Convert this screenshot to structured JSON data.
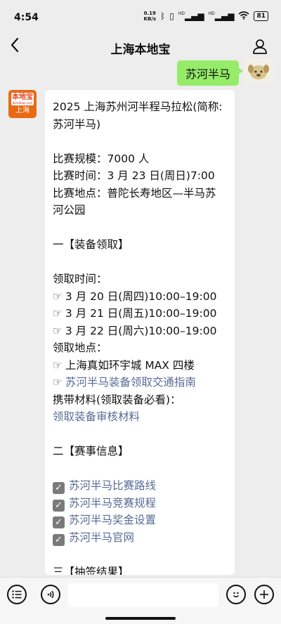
{
  "status": {
    "time": "4:54",
    "netspeed_value": "0.19",
    "netspeed_unit": "KB/s",
    "signal1": "HD",
    "signal2": "HD",
    "battery": "81"
  },
  "nav": {
    "title": "上海本地宝",
    "back_icon": "chevron-left-icon",
    "user_icon": "user-icon"
  },
  "sent": {
    "text": "苏河半马"
  },
  "bot": {
    "avatar_top": "本地宝",
    "avatar_small": "Bendibao.com",
    "avatar_bottom": "上海"
  },
  "message": {
    "title1": "2025 上海苏州河半程马拉松(简称:",
    "title2": "苏河半马)",
    "scale": "比赛规模：7000 人",
    "time": "比赛时间：3 月 23 日(周日)7:00",
    "place1": "比赛地点：普陀长寿地区—半马苏",
    "place2": "河公园",
    "sec1": "一【装备领取】",
    "pickup_time_label": "领取时间：",
    "pickup_times": [
      "3 月 20 日(周四)10:00–19:00",
      "3 月 21 日(周五)10:00–19:00",
      "3 月 22 日(周六)10:00–19:00"
    ],
    "pickup_place_label": "领取地点：",
    "pickup_place": "上海真如环宇城 MAX 四楼",
    "guide_link": "苏河半马装备领取交通指南",
    "materials_label": "携带材料(领取装备必看)：",
    "materials_link": "领取装备审核材料",
    "sec2": "二【赛事信息】",
    "info_links": [
      "苏河半马比赛路线",
      "苏河半马竞赛规程",
      "苏河半马奖金设置",
      "苏河半马官网"
    ],
    "sec3": "三【抽签结果】"
  },
  "glyphs": {
    "hand": "☞",
    "check": "✓"
  }
}
